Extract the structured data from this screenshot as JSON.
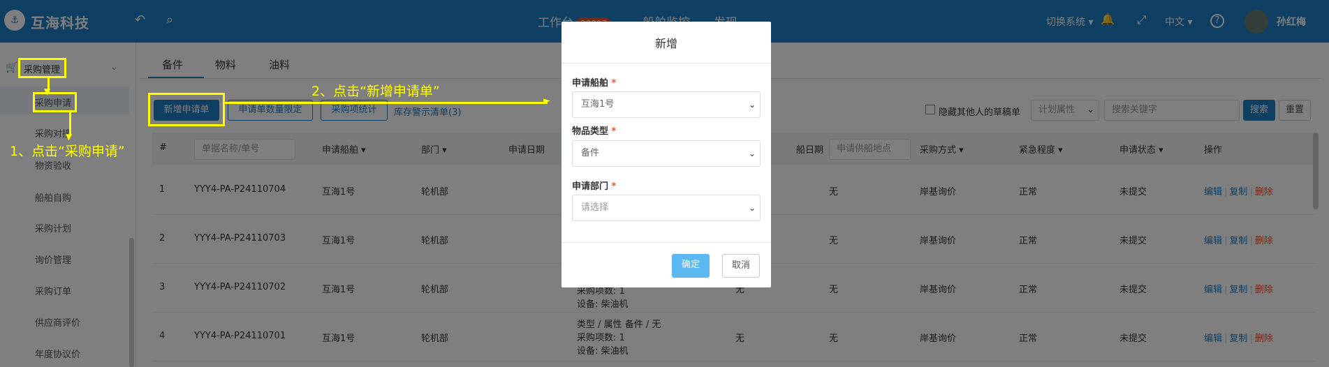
{
  "topbar": {
    "brand": "互海科技",
    "logo_glyph": "⚓",
    "back_icon": "↶",
    "search_icon": "⌕",
    "workbench": "工作台",
    "workbench_badge": "28897",
    "nav_ship": "船舶监控",
    "nav_discover": "发现",
    "switch_system": "切换系统 ▾",
    "bell_icon": "🔔",
    "fullscreen_icon": "⤢",
    "language": "中文 ▾",
    "help_icon": "?",
    "username": "孙红梅"
  },
  "sidebar": {
    "group": "采购管理",
    "items": [
      "采购申请",
      "采购对接",
      "物资验收",
      "船舶自购",
      "采购计划",
      "询价管理",
      "采购订单",
      "供应商评价",
      "年度协议价"
    ]
  },
  "tabs": [
    "备件",
    "物料",
    "油料"
  ],
  "toolbar": {
    "new_request": "新增申请单",
    "quantity_limit": "申请单数量限定",
    "purchase_stats": "采购项统计",
    "stock_warning": "库存警示清单(3)",
    "hide_drafts": "隐藏其他人的草稿单",
    "plan_attr": "计划属性",
    "search_placeholder": "搜索关键字",
    "search": "搜索",
    "reset": "重置"
  },
  "table": {
    "headers": {
      "index": "#",
      "doc_placeholder": "单据名称/单号",
      "ship": "申请船舶 ▾",
      "dept": "部门 ▾",
      "apply_date": "申请日期",
      "ship_date": "船日期",
      "supply_placeholder": "申请供船地点",
      "method": "采购方式 ▾",
      "urgency": "紧急程度 ▾",
      "status": "申请状态 ▾",
      "ops": "操作"
    },
    "rows": [
      {
        "no": "1",
        "doc": "YYY4-PA-P24110704",
        "ship": "互海1号",
        "dept": "轮机部",
        "supply": "无",
        "method": "岸基询价",
        "urgency": "正常",
        "status": "未提交"
      },
      {
        "no": "2",
        "doc": "YYY4-PA-P24110703",
        "ship": "互海1号",
        "dept": "轮机部",
        "supply": "无",
        "method": "岸基询价",
        "urgency": "正常",
        "status": "未提交"
      },
      {
        "no": "3",
        "doc": "YYY4-PA-P24110702",
        "ship": "互海1号",
        "dept": "轮机部",
        "ship_date": "无",
        "supply": "无",
        "method": "岸基询价",
        "urgency": "正常",
        "status": "未提交",
        "detail_items": "采购项数: 1",
        "detail_equip": "设备: 柴油机"
      },
      {
        "no": "4",
        "doc": "YYY4-PA-P24110701",
        "ship": "互海1号",
        "dept": "轮机部",
        "ship_date": "无",
        "supply": "无",
        "method": "岸基询价",
        "urgency": "正常",
        "status": "未提交",
        "detail_type": "类型 / 属性  备件 / 无",
        "detail_items": "采购项数: 1",
        "detail_equip": "设备: 柴油机"
      }
    ],
    "op_edit": "编辑",
    "op_copy": "复制",
    "op_delete": "删除"
  },
  "annotations": {
    "step1": "1、点击“采购申请”",
    "step2": "2、点击“新增申请单”"
  },
  "modal": {
    "title": "新增",
    "ship_label": "申请船舶",
    "ship_value": "互海1号",
    "type_label": "物品类型",
    "type_value": "备件",
    "dept_label": "申请部门",
    "dept_placeholder": "请选择",
    "required_mark": "*",
    "confirm": "确定",
    "cancel": "取消"
  },
  "colors": {
    "primary": "#1f7fc4",
    "highlight": "#ffff00",
    "danger": "#e4572e"
  }
}
